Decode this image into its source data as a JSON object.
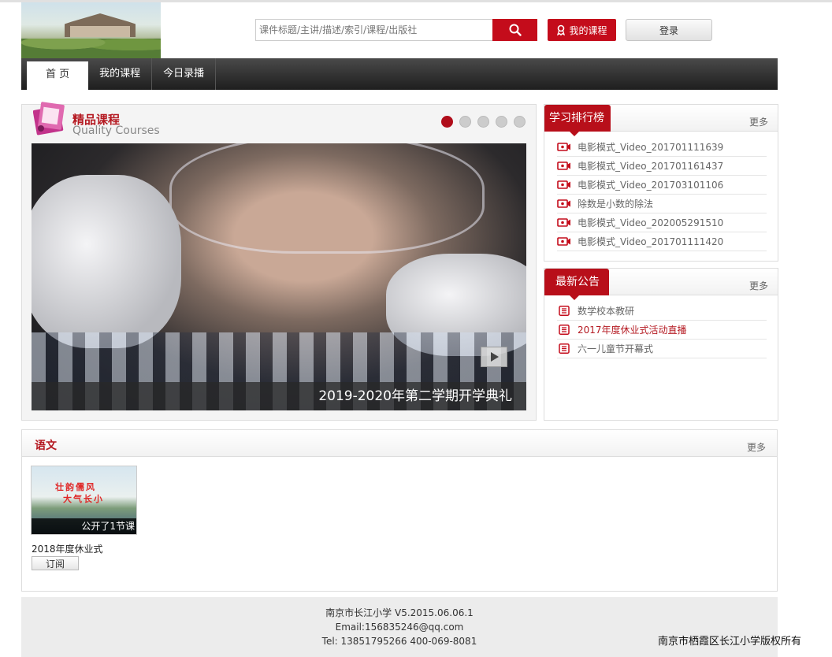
{
  "header": {
    "search": {
      "placeholder": "课件标题/主讲/描述/索引/课程/出版社"
    },
    "my_course_label": "我的课程",
    "login_label": "登录"
  },
  "nav": {
    "items": [
      "首 页",
      "我的课程",
      "今日录播"
    ],
    "active": 0
  },
  "feature": {
    "title_cn": "精品课程",
    "title_en": "Quality Courses",
    "slide_count": 5,
    "active_slide": 1,
    "caption": "2019-2020年第二学期开学典礼"
  },
  "ranking": {
    "title": "学习排行榜",
    "more": "更多",
    "items": [
      "电影模式_Video_201701111639",
      "电影模式_Video_201701161437",
      "电影模式_Video_201703101106",
      "除数是小数的除法",
      "电影模式_Video_202005291510",
      "电影模式_Video_201701111420"
    ]
  },
  "notices": {
    "title": "最新公告",
    "more": "更多",
    "items": [
      "数学校本教研",
      "2017年度休业式活动直播",
      "六一儿童节开幕式"
    ],
    "highlight_index": 1
  },
  "chinese": {
    "title": "语文",
    "more": "更多",
    "course": {
      "thumb_line1": "壮韵儒风",
      "thumb_line2": "大气长小",
      "count": "公开了1节课",
      "name": "2018年度休业式",
      "subscribe": "订阅"
    }
  },
  "footer": {
    "line1": "南京市长江小学 V5.2015.06.06.1",
    "line2": "Email:156835246@qq.com",
    "line3": "Tel: 13851795266 400-069-8081"
  },
  "copyright": "南京市栖霞区长江小学版权所有",
  "colors": {
    "brand_red": "#c40c1b",
    "nav_dark": "#1e1e1e"
  }
}
